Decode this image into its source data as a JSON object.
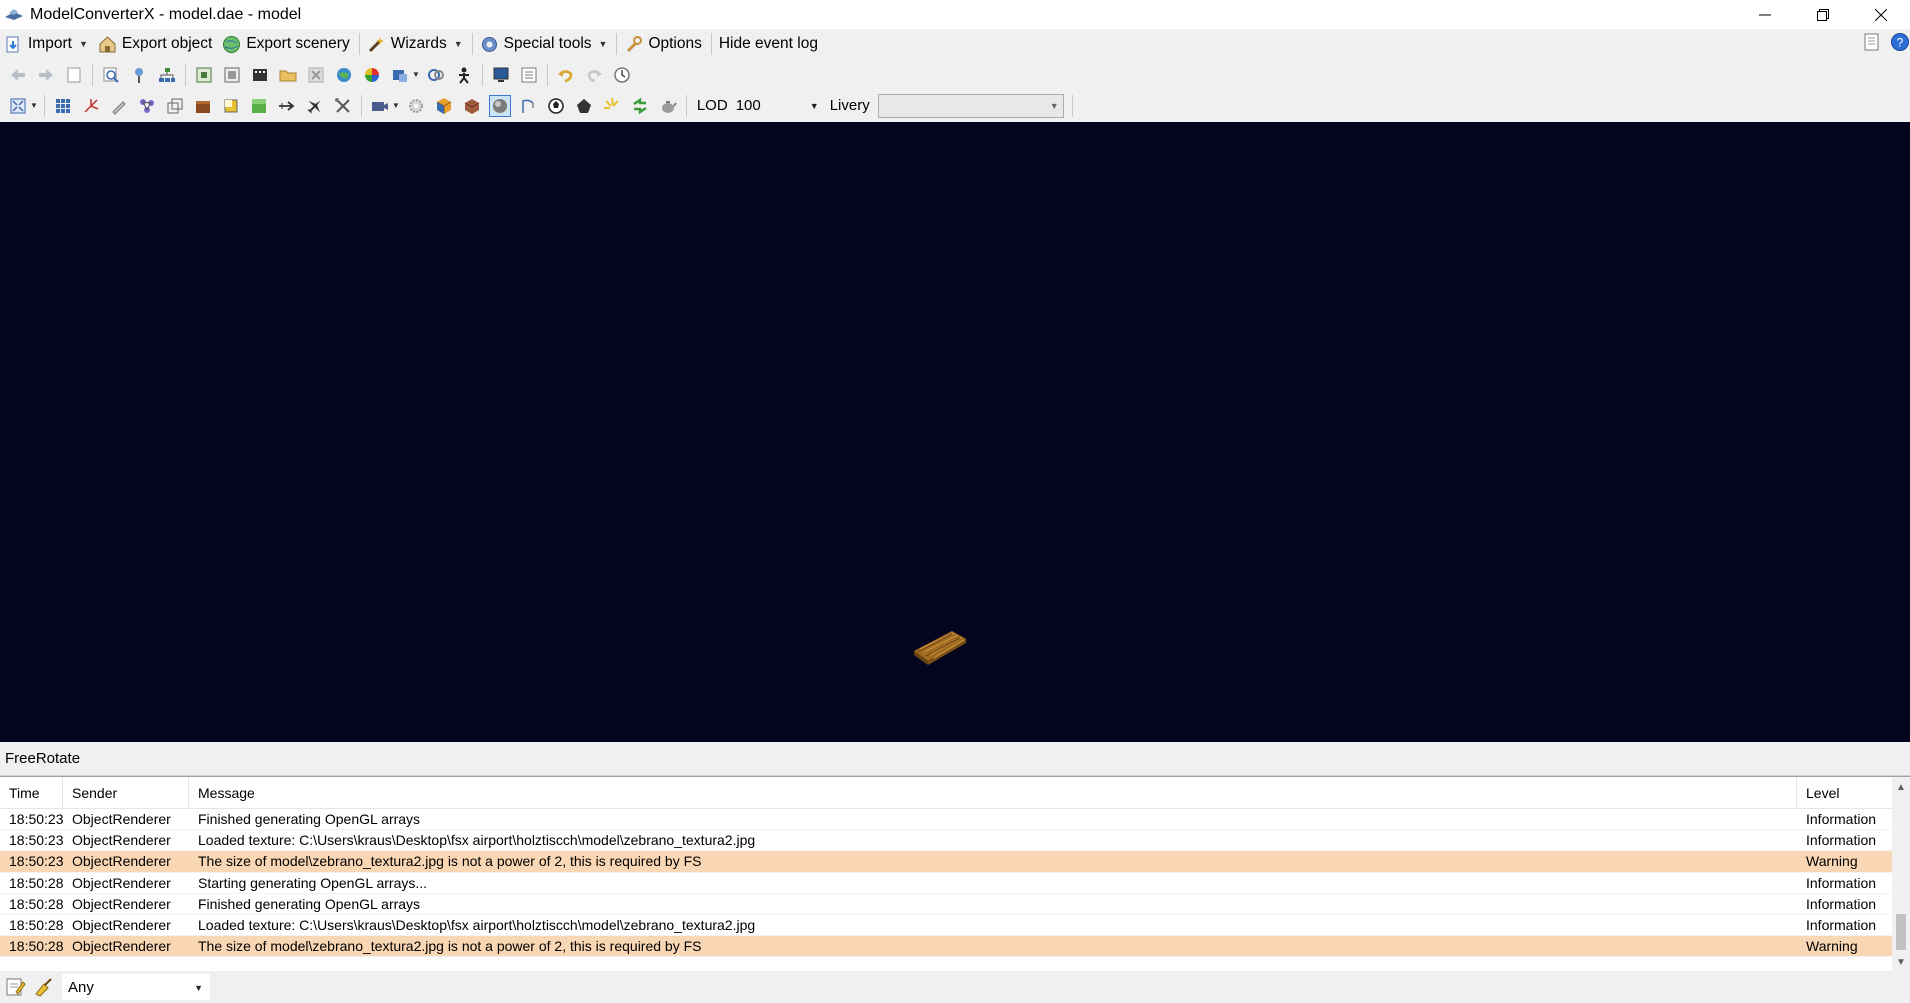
{
  "window": {
    "title": "ModelConverterX - model.dae - model"
  },
  "menubar": {
    "import": "Import",
    "export_object": "Export object",
    "export_scenery": "Export scenery",
    "wizards": "Wizards",
    "special_tools": "Special tools",
    "options": "Options",
    "hide_event_log": "Hide event log"
  },
  "toolbar2": {
    "lod_label": "LOD",
    "lod_value": "100",
    "livery_label": "Livery",
    "livery_value": ""
  },
  "status": {
    "mode": "FreeRotate"
  },
  "event_log": {
    "columns": {
      "time": "Time",
      "sender": "Sender",
      "message": "Message",
      "level": "Level"
    },
    "rows": [
      {
        "time": "18:50:23",
        "sender": "ObjectRenderer",
        "message": "Finished generating OpenGL arrays",
        "level": "Information"
      },
      {
        "time": "18:50:23",
        "sender": "ObjectRenderer",
        "message": "Loaded texture: C:\\Users\\kraus\\Desktop\\fsx airport\\holztiscch\\model\\zebrano_textura2.jpg",
        "level": "Information"
      },
      {
        "time": "18:50:23",
        "sender": "ObjectRenderer",
        "message": "The size of model\\zebrano_textura2.jpg is not a power of 2, this is required by FS",
        "level": "Warning"
      },
      {
        "time": "18:50:28",
        "sender": "ObjectRenderer",
        "message": "Starting generating OpenGL arrays...",
        "level": "Information"
      },
      {
        "time": "18:50:28",
        "sender": "ObjectRenderer",
        "message": "Finished generating OpenGL arrays",
        "level": "Information"
      },
      {
        "time": "18:50:28",
        "sender": "ObjectRenderer",
        "message": "Loaded texture: C:\\Users\\kraus\\Desktop\\fsx airport\\holztiscch\\model\\zebrano_textura2.jpg",
        "level": "Information"
      },
      {
        "time": "18:50:28",
        "sender": "ObjectRenderer",
        "message": "The size of model\\zebrano_textura2.jpg is not a power of 2, this is required by FS",
        "level": "Warning"
      }
    ]
  },
  "filter": {
    "level_value": "Any"
  },
  "colors": {
    "viewport_bg": "#05041f",
    "warning_row": "#fad7b4",
    "chrome_bg": "#f0f0f0"
  },
  "icons": {
    "toolbar1": [
      "back-arrow-icon",
      "forward-arrow-icon",
      "page-icon",
      "zoom-icon",
      "pin-icon",
      "hierarchy-icon",
      "select-icon",
      "fit-icon",
      "film-icon",
      "folder-icon",
      "cross-icon",
      "globe-icon",
      "palette-icon",
      "move-icon",
      "refresh-icon",
      "figure-icon",
      "monitor-icon",
      "list-icon",
      "undo-icon",
      "redo-icon",
      "clock-icon"
    ],
    "toolbar2": [
      "fullscreen-icon",
      "grid-icon",
      "axis-icon",
      "pencil-icon",
      "nodes-icon",
      "wireframe-icon",
      "crate-icon",
      "square-icon",
      "green-square-icon",
      "arrow-right-icon",
      "plane-icon",
      "tools-icon",
      "camera-icon",
      "gear-icon",
      "cube-icon",
      "box-icon",
      "sphere-icon",
      "crane-icon",
      "ball-icon",
      "shape-icon",
      "light-icon",
      "recycle-icon",
      "teapot-icon"
    ]
  }
}
